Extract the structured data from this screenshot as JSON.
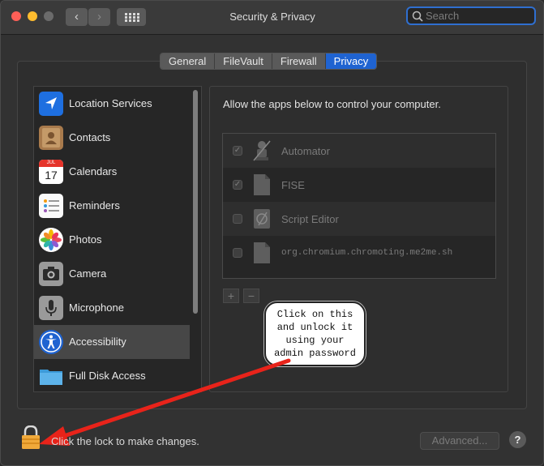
{
  "window": {
    "title": "Security & Privacy"
  },
  "search": {
    "placeholder": "Search",
    "value": ""
  },
  "tabs": [
    {
      "label": "General",
      "active": false
    },
    {
      "label": "FileVault",
      "active": false
    },
    {
      "label": "Firewall",
      "active": false
    },
    {
      "label": "Privacy",
      "active": true
    }
  ],
  "sidebar": {
    "items": [
      {
        "label": "Location Services",
        "icon": "location-arrow-icon"
      },
      {
        "label": "Contacts",
        "icon": "contacts-book-icon"
      },
      {
        "label": "Calendars",
        "icon": "calendar-icon",
        "icon_month": "JUL",
        "icon_day": "17"
      },
      {
        "label": "Reminders",
        "icon": "reminders-list-icon"
      },
      {
        "label": "Photos",
        "icon": "photos-flower-icon"
      },
      {
        "label": "Camera",
        "icon": "camera-icon"
      },
      {
        "label": "Microphone",
        "icon": "microphone-icon"
      },
      {
        "label": "Accessibility",
        "icon": "accessibility-icon",
        "selected": true
      },
      {
        "label": "Full Disk Access",
        "icon": "folder-icon"
      }
    ]
  },
  "main": {
    "heading": "Allow the apps below to control your computer.",
    "apps": [
      {
        "label": "Automator",
        "checked": true,
        "icon": "automator-robot-icon"
      },
      {
        "label": "FISE",
        "checked": true,
        "icon": "generic-document-icon"
      },
      {
        "label": "Script Editor",
        "checked": false,
        "icon": "script-editor-icon"
      },
      {
        "label": "org.chromium.chromoting.me2me.sh",
        "checked": false,
        "icon": "generic-document-icon"
      }
    ],
    "add_label": "+",
    "remove_label": "−"
  },
  "callout": {
    "text": "Click on this and unlock it using your admin password"
  },
  "footer": {
    "lock_text": "Click the lock to make changes.",
    "advanced_label": "Advanced...",
    "help_label": "?"
  },
  "colors": {
    "accent": "#1f63d1",
    "arrow": "#e8231a",
    "lock": "#f0a93a"
  }
}
